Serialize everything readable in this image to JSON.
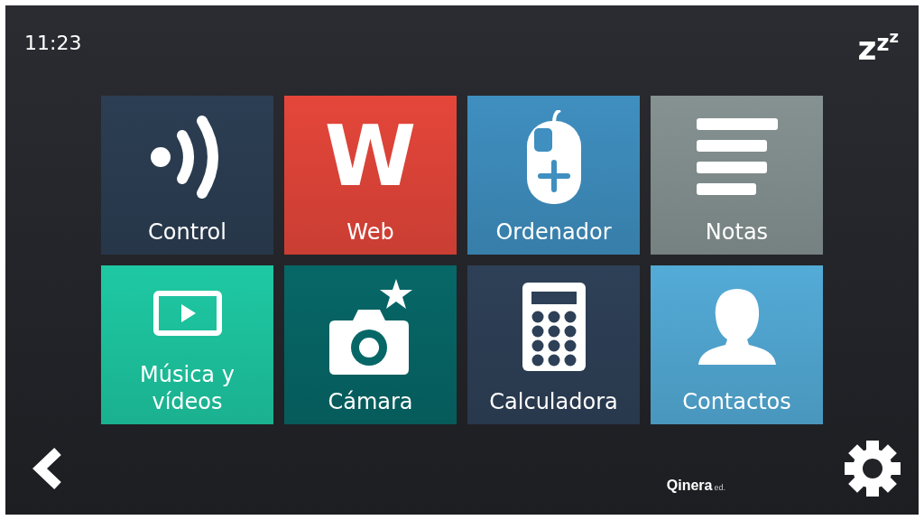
{
  "status_bar": {
    "time": "11:23",
    "sleep_button": "zzz"
  },
  "tiles": [
    {
      "label": "Control",
      "kind": "signal",
      "color": "#2c3e53"
    },
    {
      "label": "Web",
      "kind": "letter",
      "glyph": "W",
      "color": "#e5463a"
    },
    {
      "label": "Ordenador",
      "kind": "mouse",
      "color": "#3f8fc0"
    },
    {
      "label": "Notas",
      "kind": "notes",
      "color": "#869292"
    },
    {
      "label": "Música y vídeos",
      "kind": "video",
      "color": "#1ec9a3"
    },
    {
      "label": "Cámara",
      "kind": "camera",
      "color": "#076767"
    },
    {
      "label": "Calculadora",
      "kind": "calculator",
      "color": "#2e4057"
    },
    {
      "label": "Contactos",
      "kind": "contact",
      "color": "#53abd7"
    }
  ],
  "footer": {
    "brand": "Qinera",
    "brand_suffix": "ed."
  }
}
